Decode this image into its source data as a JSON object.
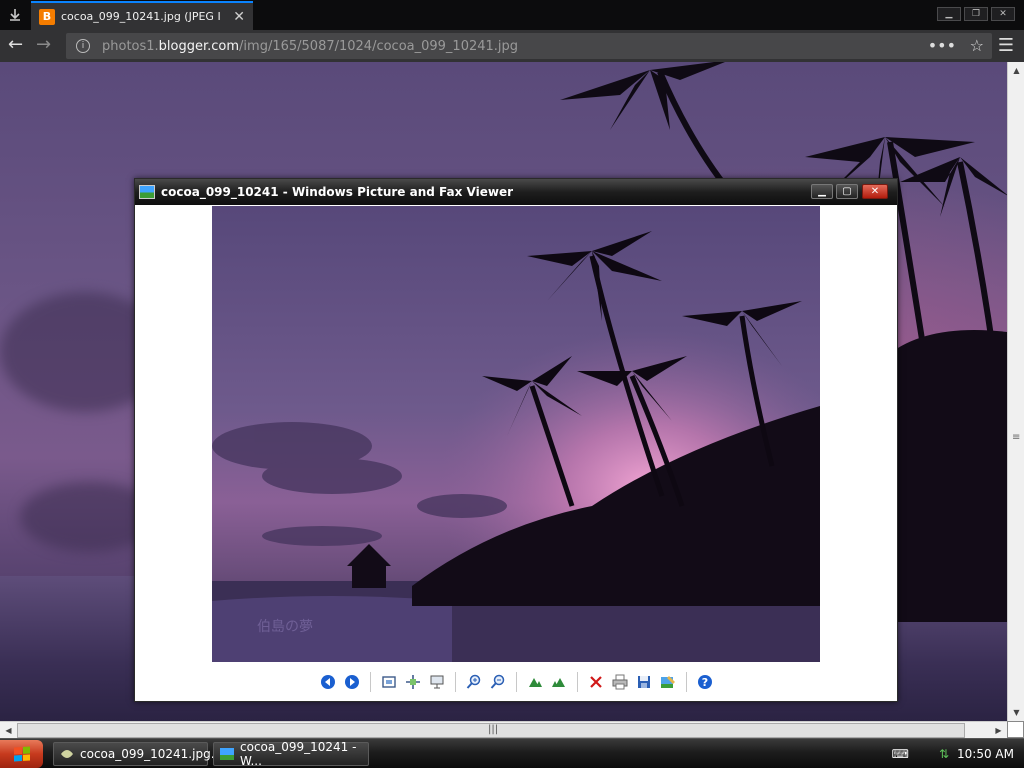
{
  "browser": {
    "tab_title": "cocoa_099_10241.jpg (JPEG Image",
    "tab_favicon": "B",
    "url_scheme_host_prefix": "photos1.",
    "url_domain": "blogger.com",
    "url_path": "/img/165/5087/1024/cocoa_099_10241.jpg"
  },
  "viewer": {
    "title": "cocoa_099_10241 - Windows Picture and Fax Viewer",
    "watermark": "伯島の夢"
  },
  "taskbar": {
    "tasks": [
      {
        "label": "cocoa_099_10241.jpg..."
      },
      {
        "label": "cocoa_099_10241 - W..."
      }
    ],
    "clock": "10:50 AM"
  },
  "colors": {
    "accent": "#0a84ff",
    "favicon": "#f57d00",
    "delete": "#d01818",
    "nav_blue": "#1a5fd0"
  },
  "icons": {
    "toolbar": [
      "previous-image",
      "next-image",
      "best-fit",
      "actual-size",
      "slideshow",
      "zoom-in",
      "zoom-out",
      "rotate-clockwise",
      "rotate-counterclockwise",
      "delete",
      "print",
      "save-copy",
      "edit",
      "help"
    ]
  }
}
